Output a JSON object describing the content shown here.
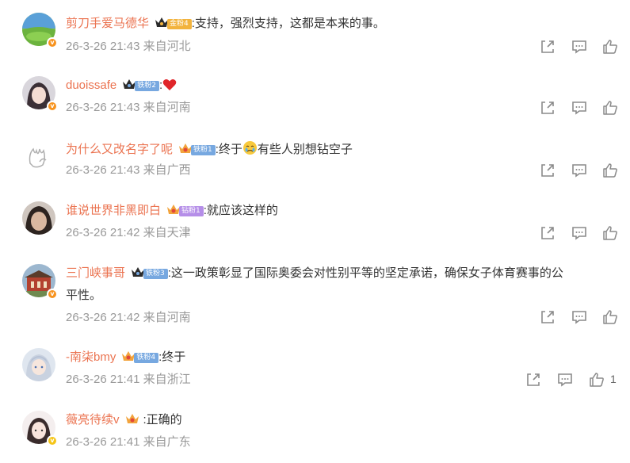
{
  "comments": [
    {
      "name": "剪刀手爱马德华",
      "fan_label": "金粉4",
      "fan_color": "#f2b33d",
      "text": ":支持，强烈支持，这都是本来的事。",
      "time": "26-3-26 21:43",
      "location": "来自河北",
      "likes": ""
    },
    {
      "name": "duoissafe",
      "fan_label": "铁粉2",
      "fan_color": "#77a8e0",
      "text": ":",
      "emoji": "heart",
      "time": "26-3-26 21:43",
      "location": "来自河南",
      "likes": ""
    },
    {
      "name": "为什么又改名字了呢",
      "fan_label": "铁粉1",
      "fan_color": "#77a8e0",
      "text_a": ":终于",
      "emoji": "crying-face",
      "text_b": "有些人别想钻空子",
      "time": "26-3-26 21:43",
      "location": "来自广西",
      "likes": ""
    },
    {
      "name": "谁说世界非黑即白",
      "fan_label": "钻粉1",
      "fan_color": "#b58ee8",
      "text": ":就应该这样的",
      "time": "26-3-26 21:42",
      "location": "来自天津",
      "likes": ""
    },
    {
      "name": "三门峡事哥",
      "fan_label": "铁粉3",
      "fan_color": "#77a8e0",
      "text": ":这一政策彰显了国际奥委会对性别平等的坚定承诺，确保女子体育赛事的公",
      "text_cont": "平性。",
      "time": "26-3-26 21:42",
      "location": "来自河南",
      "likes": ""
    },
    {
      "name": "-南柒bmy",
      "fan_label": "铁粉4",
      "fan_color": "#77a8e0",
      "text": ":终于",
      "time": "26-3-26 21:41",
      "location": "来自浙江",
      "likes": "1"
    },
    {
      "name": "薇亮待续v",
      "fan_label": "",
      "text": ":正确的",
      "time": "26-3-26 21:41",
      "location": "来自广东",
      "likes": ""
    }
  ],
  "colors": {
    "name": "#eb7350",
    "meta": "#999999",
    "icon": "#8a8a8a",
    "verified": "#f7931e"
  },
  "icons": {
    "share": "share-icon",
    "comment": "comment-icon",
    "like": "thumbs-up-icon"
  }
}
